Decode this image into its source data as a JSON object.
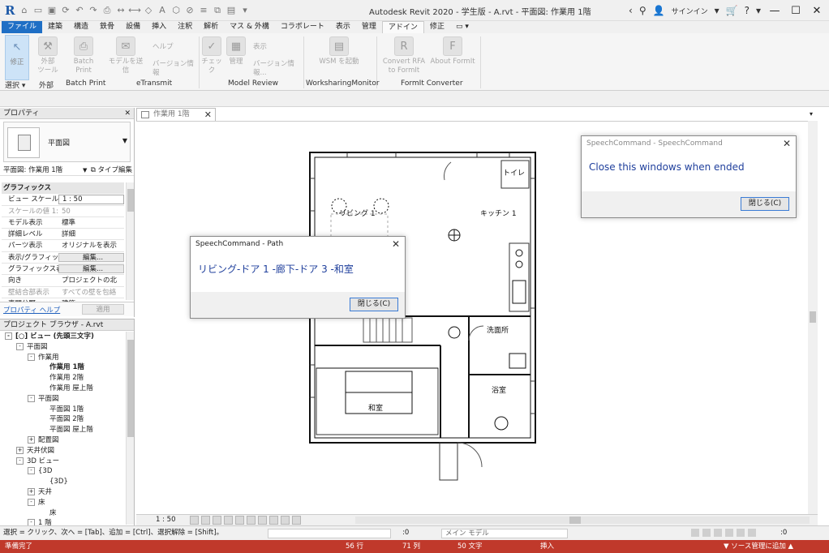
{
  "app": {
    "title": "Autodesk Revit 2020 - 学生版 - A.rvt - 平面図: 作業用 1階",
    "sign_in": "サインイン"
  },
  "ribbon_tabs": [
    "ファイル",
    "建築",
    "構造",
    "鉄骨",
    "設備",
    "挿入",
    "注釈",
    "解析",
    "マス & 外構",
    "コラボレート",
    "表示",
    "管理",
    "アドイン",
    "修正",
    "▭ ▾"
  ],
  "ribbon_buttons": {
    "modify": "修正",
    "external_tools": "外部\nツール",
    "batch_print": "Batch Print",
    "send_model": "モデルを送信",
    "help": "ヘルプ",
    "version_info": "バージョン情報",
    "check": "チェック",
    "manage": "管理",
    "display": "表示",
    "version_info2": "バージョン情報...",
    "wsm_launch": "WSM を起動",
    "convert_rfa": "Convert RFA\nto FormIt",
    "about_formit": "About FormIt"
  },
  "ribbon_panels": [
    "選択 ▾",
    "外部",
    "Batch Print",
    "eTransmit",
    "Model Review",
    "WorksharingMonitor",
    "FormIt Converter"
  ],
  "properties": {
    "header": "プロパティ",
    "type_name": "平面図",
    "instance_selector": "平面図: 作業用 1階",
    "edit_type": "タイプ編集",
    "group": "グラフィックス",
    "rows": [
      {
        "k": "ビュー スケール",
        "v": "1 : 50",
        "style": "box"
      },
      {
        "k": "スケールの値    1:",
        "v": "50",
        "style": "dim"
      },
      {
        "k": "モデル表示",
        "v": "標準",
        "style": ""
      },
      {
        "k": "詳細レベル",
        "v": "詳細",
        "style": ""
      },
      {
        "k": "パーツ表示",
        "v": "オリジナルを表示",
        "style": ""
      },
      {
        "k": "表示/グラフィッ...",
        "v": "編集...",
        "style": "btn"
      },
      {
        "k": "グラフィックス表...",
        "v": "編集...",
        "style": "btn"
      },
      {
        "k": "向き",
        "v": "プロジェクトの北",
        "style": ""
      },
      {
        "k": "壁結合部表示",
        "v": "すべての壁を包絡",
        "style": "dim"
      },
      {
        "k": "専門分野",
        "v": "建築",
        "style": ""
      }
    ],
    "help_link": "プロパティ ヘルプ",
    "apply": "適用"
  },
  "browser": {
    "header": "プロジェクト ブラウザ - A.rvt",
    "items": [
      {
        "t": "-",
        "label": "[○] ビュー (先頭三文字)",
        "indent": 0,
        "bold": true
      },
      {
        "t": "-",
        "label": "平面図",
        "indent": 1,
        "bold": false
      },
      {
        "t": "-",
        "label": "作業用",
        "indent": 2,
        "bold": false
      },
      {
        "t": "",
        "label": "作業用 1階",
        "indent": 3,
        "bold": true
      },
      {
        "t": "",
        "label": "作業用 2階",
        "indent": 3,
        "bold": false
      },
      {
        "t": "",
        "label": "作業用 屋上階",
        "indent": 3,
        "bold": false
      },
      {
        "t": "-",
        "label": "平面図",
        "indent": 2,
        "bold": false
      },
      {
        "t": "",
        "label": "平面図 1階",
        "indent": 3,
        "bold": false
      },
      {
        "t": "",
        "label": "平面図 2階",
        "indent": 3,
        "bold": false
      },
      {
        "t": "",
        "label": "平面図 屋上階",
        "indent": 3,
        "bold": false
      },
      {
        "t": "+",
        "label": "配置図",
        "indent": 2,
        "bold": false
      },
      {
        "t": "+",
        "label": "天井伏図",
        "indent": 1,
        "bold": false
      },
      {
        "t": "-",
        "label": "3D ビュー",
        "indent": 1,
        "bold": false
      },
      {
        "t": "-",
        "label": "{3D",
        "indent": 2,
        "bold": false
      },
      {
        "t": "",
        "label": "{3D}",
        "indent": 3,
        "bold": false
      },
      {
        "t": "+",
        "label": "天井",
        "indent": 2,
        "bold": false
      },
      {
        "t": "-",
        "label": "床",
        "indent": 2,
        "bold": false
      },
      {
        "t": "",
        "label": "床",
        "indent": 3,
        "bold": false
      },
      {
        "t": "-",
        "label": "1 階",
        "indent": 2,
        "bold": false
      }
    ]
  },
  "view_tab": "作業用 1階",
  "floorplan": {
    "rooms": {
      "toilet": "トイレ",
      "living": "リビング 1",
      "kitchen": "キッチン 1",
      "washroom": "洗面所",
      "bath": "浴室",
      "washitsu": "和室"
    }
  },
  "view_control": {
    "scale": "1 : 50"
  },
  "status": {
    "message": "選択 = クリック、次へ = [Tab]、追加 = [Ctrl]、選択解除 = [Shift]。",
    "zero1": ":0",
    "model": "メイン モデル",
    "zero2": ":0"
  },
  "bottombar": {
    "ready": "準備完了",
    "row": "56 行",
    "col": "71 列",
    "chars": "50 文字",
    "insert": "挿入",
    "right": "▼ ソース管理に追加 ▲"
  },
  "dialog1": {
    "title": "SpeechCommand - SpeechCommand",
    "message": "Close this windows when ended",
    "close": "閉じる(C)"
  },
  "dialog2": {
    "title": "SpeechCommand - Path",
    "message": "リビング-ドア 1 -廊下-ドア 3 -和室",
    "close": "閉じる(C)"
  },
  "colors": {
    "accent": "#1f6fc5",
    "statusbar": "#c0392b",
    "dialog_text": "#1f3f9c"
  }
}
